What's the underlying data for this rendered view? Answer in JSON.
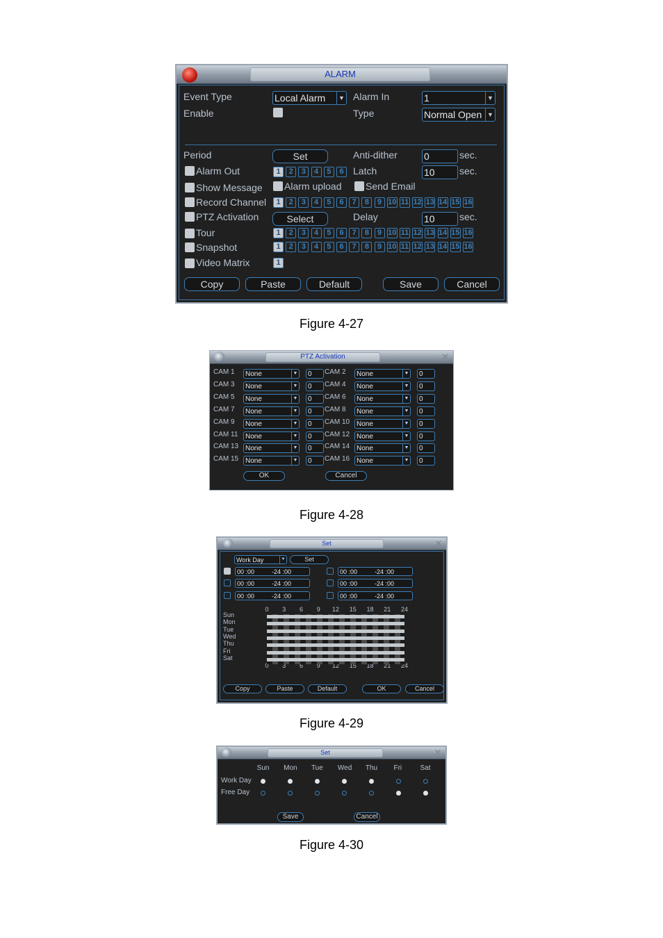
{
  "figures": [
    {
      "caption": "Figure 4-27"
    },
    {
      "caption": "Figure 4-28"
    },
    {
      "caption": "Figure 4-29"
    },
    {
      "caption": "Figure 4-30"
    }
  ],
  "alarm": {
    "title": "ALARM",
    "event_type_label": "Event Type",
    "event_type_value": "Local Alarm",
    "alarm_in_label": "Alarm In",
    "alarm_in_value": "1",
    "enable_label": "Enable",
    "enable_checked": false,
    "type_label": "Type",
    "type_value": "Normal Open",
    "period_label": "Period",
    "set_button": "Set",
    "anti_dither_label": "Anti-dither",
    "anti_dither_value": "0",
    "latch_label": "Latch",
    "latch_value": "10",
    "delay_label": "Delay",
    "delay_value": "10",
    "sec_unit": "sec.",
    "alarm_out_label": "Alarm Out",
    "alarm_out_channels": [
      "1",
      "2",
      "3",
      "4",
      "5",
      "6"
    ],
    "show_message_label": "Show Message",
    "alarm_upload_label": "Alarm upload",
    "send_email_label": "Send Email",
    "record_channel_label": "Record Channel",
    "ptz_activation_label": "PTZ Activation",
    "select_button": "Select",
    "tour_label": "Tour",
    "snapshot_label": "Snapshot",
    "video_matrix_label": "Video Matrix",
    "channels16": [
      "1",
      "2",
      "3",
      "4",
      "5",
      "6",
      "7",
      "8",
      "9",
      "10",
      "11",
      "12",
      "13",
      "14",
      "15",
      "16"
    ],
    "video_matrix_channels": [
      "1"
    ],
    "selected_channel": "1",
    "buttons": {
      "copy": "Copy",
      "paste": "Paste",
      "default": "Default",
      "save": "Save",
      "cancel": "Cancel"
    }
  },
  "ptz": {
    "title": "PTZ Activation",
    "rows": [
      {
        "cam": "CAM 1",
        "action": "None",
        "value": "0"
      },
      {
        "cam": "CAM 2",
        "action": "None",
        "value": "0"
      },
      {
        "cam": "CAM 3",
        "action": "None",
        "value": "0"
      },
      {
        "cam": "CAM 4",
        "action": "None",
        "value": "0"
      },
      {
        "cam": "CAM 5",
        "action": "None",
        "value": "0"
      },
      {
        "cam": "CAM 6",
        "action": "None",
        "value": "0"
      },
      {
        "cam": "CAM 7",
        "action": "None",
        "value": "0"
      },
      {
        "cam": "CAM 8",
        "action": "None",
        "value": "0"
      },
      {
        "cam": "CAM 9",
        "action": "None",
        "value": "0"
      },
      {
        "cam": "CAM 10",
        "action": "None",
        "value": "0"
      },
      {
        "cam": "CAM 11",
        "action": "None",
        "value": "0"
      },
      {
        "cam": "CAM 12",
        "action": "None",
        "value": "0"
      },
      {
        "cam": "CAM 13",
        "action": "None",
        "value": "0"
      },
      {
        "cam": "CAM 14",
        "action": "None",
        "value": "0"
      },
      {
        "cam": "CAM 15",
        "action": "None",
        "value": "0"
      },
      {
        "cam": "CAM 16",
        "action": "None",
        "value": "0"
      }
    ],
    "ok": "OK",
    "cancel": "Cancel"
  },
  "period": {
    "title": "Set",
    "day_value": "Work Day",
    "set_button": "Set",
    "periods": [
      {
        "start": "00 :00",
        "end": "-24 :00",
        "checked": true
      },
      {
        "start": "00 :00",
        "end": "-24 :00",
        "checked": false
      },
      {
        "start": "00 :00",
        "end": "-24 :00",
        "checked": false
      },
      {
        "start": "00 :00",
        "end": "-24 :00",
        "checked": false
      },
      {
        "start": "00 :00",
        "end": "-24 :00",
        "checked": false
      },
      {
        "start": "00 :00",
        "end": "-24 :00",
        "checked": false
      }
    ],
    "days": [
      "Sun",
      "Mon",
      "Tue",
      "Wed",
      "Thu",
      "Fri",
      "Sat"
    ],
    "hour_ticks": [
      "0",
      "3",
      "6",
      "9",
      "12",
      "15",
      "18",
      "21",
      "24"
    ],
    "buttons": {
      "copy": "Copy",
      "paste": "Paste",
      "default": "Default",
      "ok": "OK",
      "cancel": "Cancel"
    }
  },
  "workday": {
    "title": "Set",
    "days": [
      "Sun",
      "Mon",
      "Tue",
      "Wed",
      "Thu",
      "Fri",
      "Sat"
    ],
    "rows": [
      {
        "label": "Work Day",
        "selected": [
          true,
          true,
          true,
          true,
          true,
          false,
          false
        ]
      },
      {
        "label": "Free Day",
        "selected": [
          false,
          false,
          false,
          false,
          false,
          true,
          true
        ]
      }
    ],
    "save": "Save",
    "cancel": "Cancel"
  }
}
